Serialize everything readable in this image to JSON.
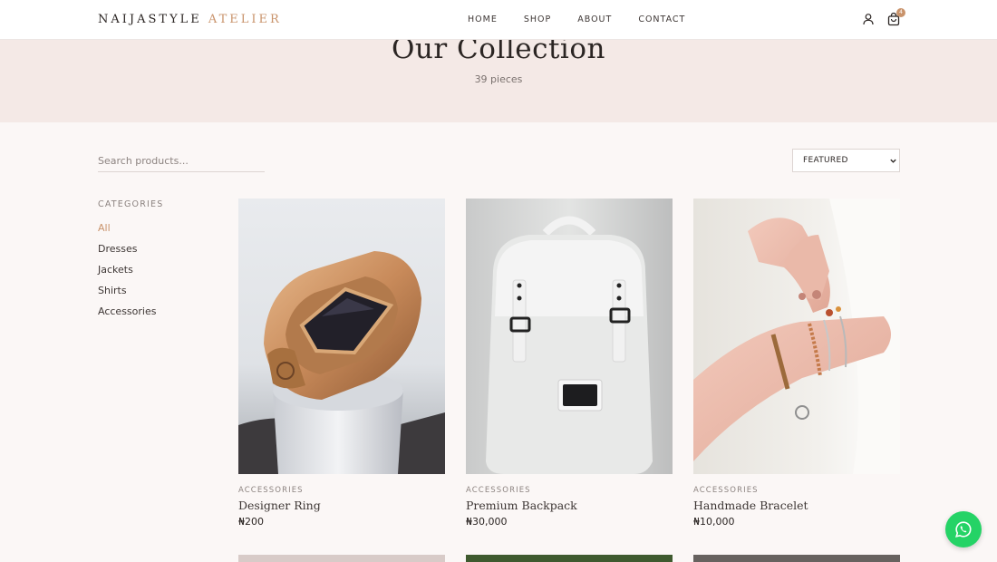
{
  "brand": {
    "name": "NAIJASTYLE",
    "accent": "ATELIER",
    "accent_color": "#c9936b"
  },
  "nav": [
    {
      "label": "HOME"
    },
    {
      "label": "SHOP"
    },
    {
      "label": "ABOUT"
    },
    {
      "label": "CONTACT"
    }
  ],
  "header_icons": {
    "account": "user-icon",
    "cart": "shopping-bag-icon",
    "cart_count": "4"
  },
  "hero": {
    "title": "Our Collection",
    "count": "39 pieces"
  },
  "search": {
    "placeholder": "Search products...",
    "value": ""
  },
  "sort": {
    "selected": "FEATURED"
  },
  "categories": {
    "heading": "CATEGORIES",
    "items": [
      {
        "label": "All",
        "active": true
      },
      {
        "label": "Dresses",
        "active": false
      },
      {
        "label": "Jackets",
        "active": false
      },
      {
        "label": "Shirts",
        "active": false
      },
      {
        "label": "Accessories",
        "active": false
      }
    ]
  },
  "products": [
    {
      "category": "ACCESSORIES",
      "name": "Designer Ring",
      "price": "₦200",
      "image": "gold ring with black gemstone"
    },
    {
      "category": "ACCESSORIES",
      "name": "Premium Backpack",
      "price": "₦30,000",
      "image": "white backpack"
    },
    {
      "category": "ACCESSORIES",
      "name": "Handmade Bracelet",
      "price": "₦10,000",
      "image": "wrist wearing beaded bracelets"
    }
  ],
  "whatsapp": {
    "icon": "whatsapp-icon",
    "color": "#25d366"
  }
}
